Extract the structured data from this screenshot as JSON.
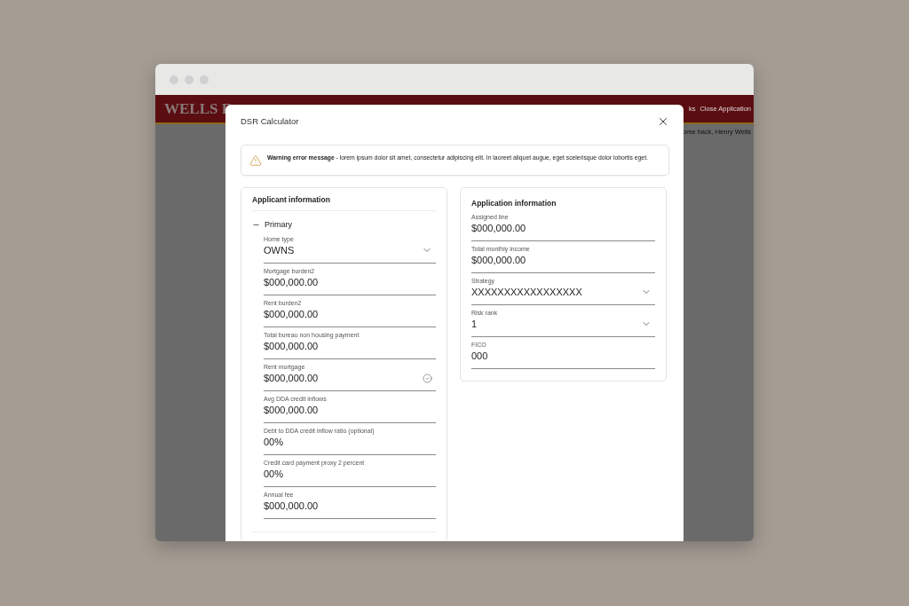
{
  "page": {
    "logo": "WELLS F",
    "nav_links": [
      "ks",
      "Close Application"
    ],
    "greeting": "ome back, Henry Wells"
  },
  "modal": {
    "title": "DSR Calculator",
    "warning": "**Warning error message** - lorem ipsum dolor sit amet, consectetur adipiscing elit. In laoreet aliquet augue, eget scelerisque dolor lobortis eget.",
    "applicant": {
      "title": "Applicant information",
      "section": {
        "label": "Primary",
        "expanded": true,
        "fields": [
          {
            "label": "Home type",
            "value": "OWNS",
            "kind": "select",
            "valid": false
          },
          {
            "label": "Mortgage burden2",
            "value": "$000,000.00",
            "kind": "text",
            "valid": false
          },
          {
            "label": "Rent burden2",
            "value": "$000,000.00",
            "kind": "text",
            "valid": false
          },
          {
            "label": "Total bureau non housing payment",
            "value": "$000,000.00",
            "kind": "text",
            "valid": false
          },
          {
            "label": "Rent mortgage",
            "value": "$000,000.00",
            "kind": "text",
            "valid": true
          },
          {
            "label": "Avg DDA credit inflows",
            "value": "$000,000.00",
            "kind": "text",
            "valid": false
          },
          {
            "label": "Debt to DDA credit inflow ratio (optional)",
            "value": "00%",
            "kind": "text",
            "valid": false
          },
          {
            "label": "Credit card payment proxy 2 percent",
            "value": "00%",
            "kind": "text",
            "valid": false
          },
          {
            "label": "Annual fee",
            "value": "$000,000.00",
            "kind": "text",
            "valid": false
          }
        ]
      }
    },
    "application": {
      "title": "Application information",
      "fields": [
        {
          "label": "Assigned line",
          "value": "$000,000.00",
          "kind": "text",
          "valid": false
        },
        {
          "label": "Total monthly income",
          "value": "$000,000.00",
          "kind": "text",
          "valid": false
        },
        {
          "label": "Strategy",
          "value": "XXXXXXXXXXXXXXXXX",
          "kind": "select",
          "valid": false
        },
        {
          "label": "Risk rank",
          "value": "1",
          "kind": "select",
          "valid": false
        },
        {
          "label": "FICO",
          "value": "000",
          "kind": "text",
          "valid": false
        }
      ]
    }
  }
}
